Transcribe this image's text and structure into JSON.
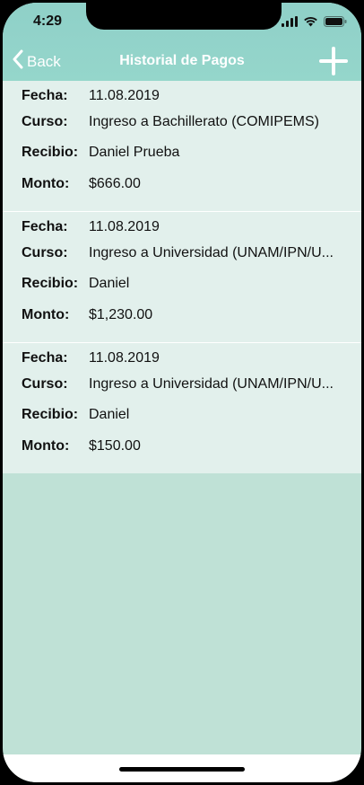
{
  "status_bar": {
    "time": "4:29",
    "icons": [
      "signal-icon",
      "wifi-icon",
      "battery-icon"
    ]
  },
  "nav": {
    "back_label": "Back",
    "title": "Historial de Pagos",
    "add_icon": "plus-icon"
  },
  "labels": {
    "fecha": "Fecha:",
    "curso": "Curso:",
    "recibio": "Recibio:",
    "monto": "Monto:"
  },
  "payments": [
    {
      "fecha": "11.08.2019",
      "curso": "Ingreso a Bachillerato (COMIPEMS)",
      "recibio": "Daniel Prueba",
      "monto": "$666.00"
    },
    {
      "fecha": "11.08.2019",
      "curso": "Ingreso a Universidad (UNAM/IPN/U...",
      "recibio": "Daniel",
      "monto": "$1,230.00"
    },
    {
      "fecha": "11.08.2019",
      "curso": "Ingreso a Universidad (UNAM/IPN/U...",
      "recibio": "Daniel",
      "monto": "$150.00"
    }
  ],
  "colors": {
    "header": "#8fd0c8",
    "row_background": "#e2f0ec",
    "page_background": "#bfe1d6",
    "nav_text": "#ffffff"
  }
}
